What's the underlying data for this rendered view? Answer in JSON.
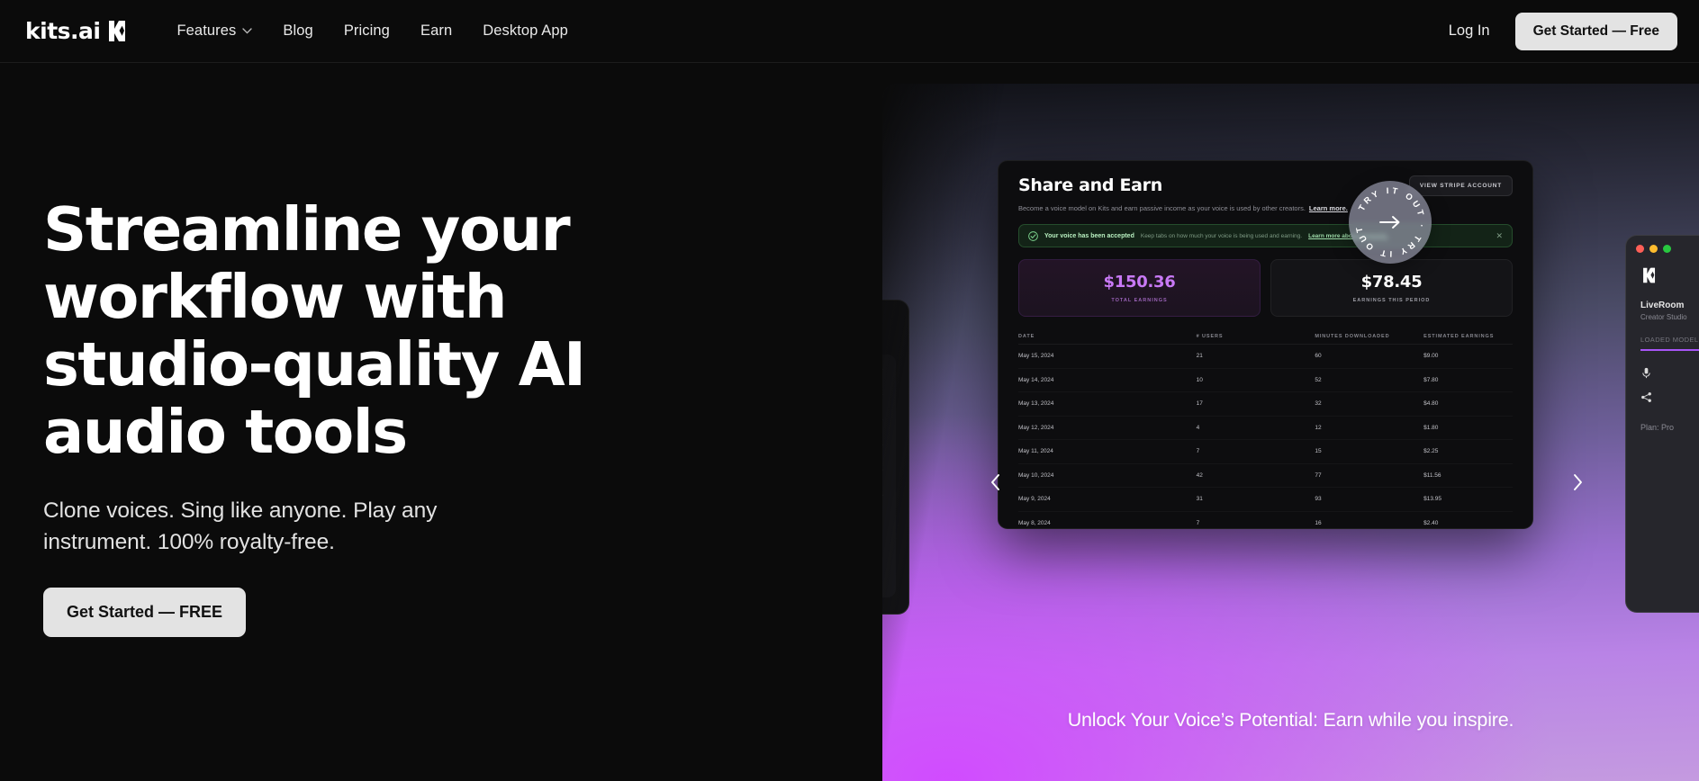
{
  "nav": {
    "brand": "kits.ai",
    "brand_icon": "kits-logo-mark",
    "links": [
      {
        "label": "Features",
        "has_dropdown": true,
        "icon": "chevron-down-icon"
      },
      {
        "label": "Blog",
        "has_dropdown": false
      },
      {
        "label": "Pricing",
        "has_dropdown": false
      },
      {
        "label": "Earn",
        "has_dropdown": false
      },
      {
        "label": "Desktop App",
        "has_dropdown": false
      }
    ],
    "login_label": "Log In",
    "cta_label": "Get Started — Free"
  },
  "hero": {
    "headline": "Streamline your workflow with studio-quality AI audio tools",
    "subhead": "Clone voices. Sing like anyone. Play any instrument.  100% royalty-free.",
    "cta_label": "Get Started — FREE",
    "caption": "Unlock Your Voice’s Potential: Earn while you inspire."
  },
  "carousel": {
    "prev_icon": "chevron-left-icon",
    "next_icon": "chevron-right-icon",
    "badge_text": "TRY IT OUT · TRY IT OUT ·",
    "badge_arrow_icon": "arrow-right-icon"
  },
  "dashboard": {
    "title": "Share and Earn",
    "stripe_button": "VIEW STRIPE ACCOUNT",
    "description": "Become a voice model on Kits and earn passive income as your voice is used by other creators.",
    "description_link": "Learn more.",
    "banner": {
      "icon": "check-circle-icon",
      "title": "Your voice has been accepted",
      "body": "Keep tabs on how much your voice is being used and earning.",
      "link": "Learn more about payments.",
      "close_icon": "close-icon"
    },
    "stats": [
      {
        "value": "$150.36",
        "label": "TOTAL EARNINGS",
        "color": "#c879f5"
      },
      {
        "value": "$78.45",
        "label": "EARNINGS THIS PERIOD",
        "color": "#ffffff"
      }
    ],
    "table": {
      "columns": [
        "DATE",
        "# USERS",
        "MINUTES DOWNLOADED",
        "ESTIMATED EARNINGS"
      ],
      "rows": [
        [
          "May 15, 2024",
          "21",
          "60",
          "$9.00"
        ],
        [
          "May 14, 2024",
          "10",
          "52",
          "$7.80"
        ],
        [
          "May 13, 2024",
          "17",
          "32",
          "$4.80"
        ],
        [
          "May 12, 2024",
          "4",
          "12",
          "$1.80"
        ],
        [
          "May 11, 2024",
          "7",
          "15",
          "$2.25"
        ],
        [
          "May 10, 2024",
          "42",
          "77",
          "$11.56"
        ],
        [
          "May 9, 2024",
          "31",
          "93",
          "$13.95"
        ],
        [
          "May 8, 2024",
          "7",
          "16",
          "$2.40"
        ]
      ]
    }
  },
  "side_card_right": {
    "title": "LiveRoom",
    "subtitle": "Creator Studio",
    "section": "LOADED MODEL",
    "footer": "Plan: Pro",
    "icons": [
      "microphone-icon",
      "share-icon"
    ],
    "window_dots": [
      "#ff5f57",
      "#febc2e",
      "#28c840"
    ]
  },
  "colors": {
    "page_bg": "#0b0b0b",
    "cta_bg": "#e3e3e3",
    "accent_purple": "#c879f5",
    "panel_purple": "#d14bff"
  }
}
